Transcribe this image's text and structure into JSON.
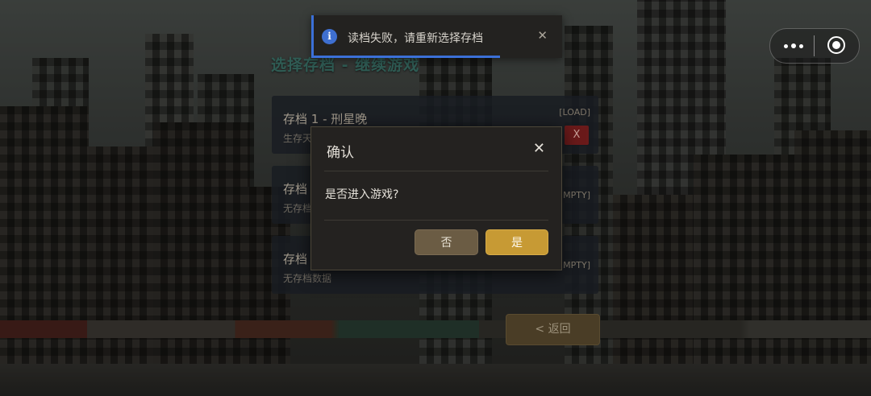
{
  "screen": {
    "title": "选择存档 - 继续游戏",
    "back_label": "< 返回"
  },
  "slots": [
    {
      "name": "存档 1 - 刑星晚",
      "sub": "生存天",
      "tag": "[LOAD]",
      "delete_label": "X"
    },
    {
      "name": "存档",
      "sub": "无存档",
      "tag": "MPTY]"
    },
    {
      "name": "存档",
      "sub": "无存档数据",
      "tag": "MPTY]"
    }
  ],
  "toast": {
    "icon": "info-icon",
    "icon_glyph": "i",
    "message": "读档失败，请重新选择存档",
    "close_glyph": "✕",
    "progress": 0.75,
    "accent_color": "#3b70d8"
  },
  "capsule": {
    "more_icon": "more-dots-icon",
    "close_icon": "miniprogram-close-icon"
  },
  "dialog": {
    "title": "确认",
    "close_glyph": "✕",
    "message": "是否进入游戏?",
    "cancel_label": "否",
    "confirm_label": "是",
    "confirm_color": "#c79a34",
    "cancel_color": "#6b5c44"
  }
}
